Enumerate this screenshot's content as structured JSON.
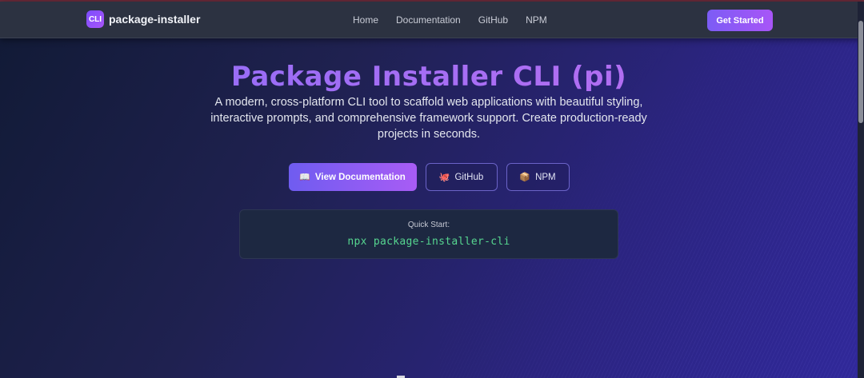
{
  "brand": {
    "logo_text": "CLI",
    "name": "package-installer"
  },
  "nav": {
    "links": [
      "Home",
      "Documentation",
      "GitHub",
      "NPM"
    ],
    "cta": "Get Started"
  },
  "hero": {
    "title": "Package Installer CLI (pi)",
    "description": "A modern, cross-platform CLI tool to scaffold web applications with beautiful styling, interactive prompts, and comprehensive framework support. Create production-ready projects in seconds."
  },
  "buttons": {
    "docs": {
      "icon": "📖",
      "label": "View Documentation"
    },
    "github": {
      "icon": "🐙",
      "label": "GitHub"
    },
    "npm": {
      "icon": "📦",
      "label": "NPM"
    }
  },
  "quickstart": {
    "label": "Quick Start:",
    "command": "npx package-installer-cli"
  },
  "colors": {
    "accent": "#7c5cf5",
    "accent2": "#a855f7",
    "command": "#56d690"
  }
}
